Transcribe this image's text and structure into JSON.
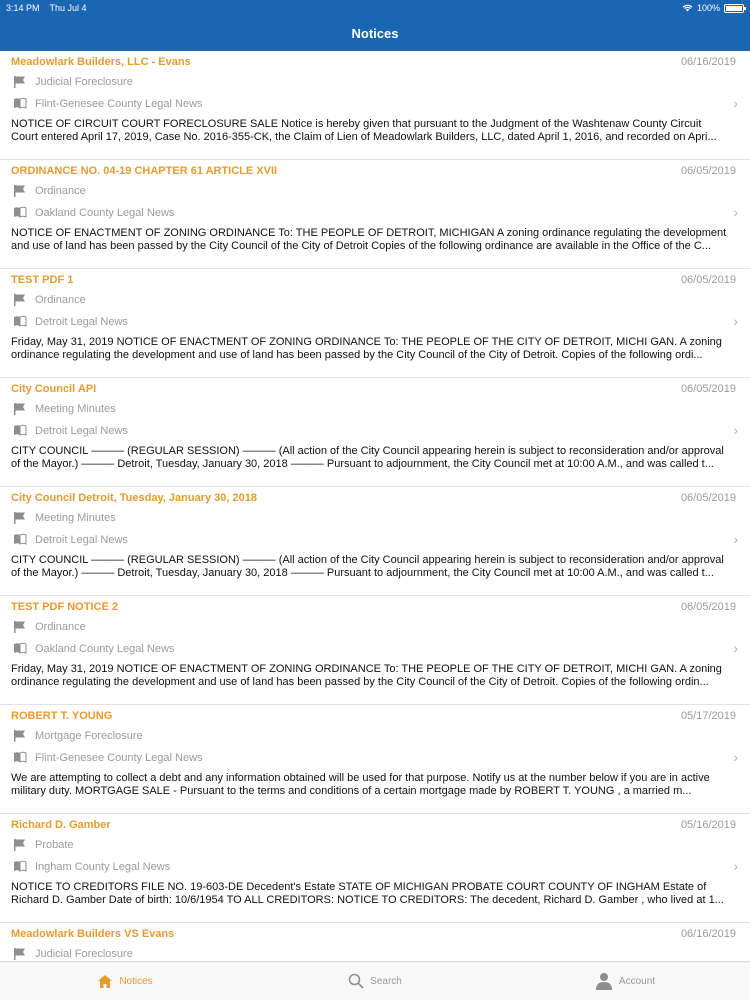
{
  "status": {
    "time": "3:14 PM",
    "date": "Thu Jul 4",
    "battery": "100%",
    "battery_level": 1.0
  },
  "header": {
    "title": "Notices"
  },
  "notices": [
    {
      "title": "Meadowlark Builders, LLC - Evans",
      "date": "06/16/2019",
      "category": "Judicial Foreclosure",
      "source": "Flint-Genesee County Legal News",
      "excerpt": "NOTICE OF CIRCUIT COURT FORECLOSURE SALE Notice is hereby given that pursuant to the Judgment of the Washtenaw County Circuit Court entered April 17, 2019, Case No. 2016-355-CK, the Claim of Lien of Meadowlark Builders, LLC, dated April 1, 2016, and recorded on Apri..."
    },
    {
      "title": "ORDINANCE NO. 04-19 CHAPTER 61 ARTICLE XVII",
      "date": "06/05/2019",
      "category": "Ordinance",
      "source": "Oakland County Legal News",
      "excerpt": "NOTICE OF ENACTMENT OF ZONING ORDINANCE To: THE PEOPLE OF DETROIT, MICHIGAN A zoning ordinance regulating the development and use of land has been passed by the City Council of the City of Detroit Copies of the following ordinance are available in the Office of the C..."
    },
    {
      "title": "TEST PDF 1",
      "date": "06/05/2019",
      "category": "Ordinance",
      "source": "Detroit Legal News",
      "excerpt": "Friday, May 31, 2019 NOTICE OF ENACTMENT OF ZONING ORDINANCE To: THE  PEOPLE  OF  THE  CITY  OF DETROIT, MICHI GAN.  A  zoning ordinance  regulating  the development and use of land has been passed by the City Council of the City of Detroit. Copies of the following ordi..."
    },
    {
      "title": "City Council API",
      "date": "06/05/2019",
      "category": "Meeting Minutes",
      "source": "Detroit Legal News",
      "excerpt": "CITY COUNCIL ——— (REGULAR SESSION) ——— (All action of the City Council appearing herein is subject to reconsideration and/or approval of the Mayor.) ——— Detroit, Tuesday, January 30, 2018 ——— Pursuant to adjournment, the City Council met at 10:00 A.M., and was called t..."
    },
    {
      "title": "City Council Detroit, Tuesday, January 30, 2018",
      "date": "06/05/2019",
      "category": "Meeting Minutes",
      "source": "Detroit Legal News",
      "excerpt": "CITY COUNCIL ——— (REGULAR SESSION) ——— (All action of the City Council appearing herein is subject to reconsideration and/or approval of the Mayor.) ——— Detroit, Tuesday, January 30, 2018 ——— Pursuant to adjournment, the City Council met at 10:00 A.M., and was called t..."
    },
    {
      "title": "TEST PDF NOTICE 2",
      "date": "06/05/2019",
      "category": "Ordinance",
      "source": "Oakland County Legal News",
      "excerpt": "Friday, May 31, 2019 NOTICE OF ENACTMENT OF ZONING ORDINANCE To: THE PEOPLE OF THE CITY OF DETROIT, MICHI GAN. A zoning ordinance regulating the development and use of land has been passed by the City Council of the City of Detroit. Copies of the following ordin..."
    },
    {
      "title": "ROBERT T. YOUNG",
      "date": "05/17/2019",
      "category": "Mortgage Foreclosure",
      "source": "Flint-Genesee County Legal News",
      "excerpt": "We are attempting to collect a debt and any information obtained will be used for that purpose.  Notify us at the number below if you are in active military duty. MORTGAGE SALE - Pursuant to the terms and conditions of a certain mortgage made by ROBERT T. YOUNG , a married m..."
    },
    {
      "title": "Richard D. Gamber",
      "date": "05/16/2019",
      "category": "Probate",
      "source": "Ingham County Legal News",
      "excerpt": "NOTICE TO CREDITORS  FILE NO. 19-603-DE Decedent's Estate  STATE OF MICHIGAN  PROBATE COURT  COUNTY OF INGHAM Estate of Richard D. Gamber Date of birth:  10/6/1954 TO ALL CREDITORS:  NOTICE TO CREDITORS:  The decedent,  Richard D. Gamber , who lived at 1..."
    },
    {
      "title": "Meadowlark Builders VS Evans",
      "date": "06/16/2019",
      "category": "Judicial Foreclosure",
      "source": "",
      "excerpt": ""
    }
  ],
  "tabs": {
    "notices": "Notices",
    "search": "Search",
    "account": "Account"
  },
  "colors": {
    "brand": "#1a66b3",
    "accent": "#e49b30"
  }
}
